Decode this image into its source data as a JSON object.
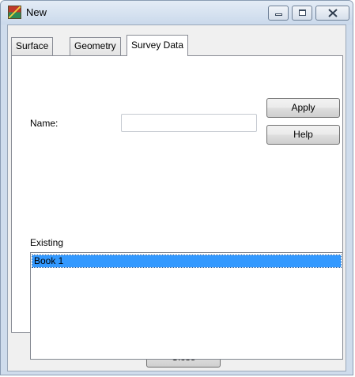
{
  "window": {
    "title": "New"
  },
  "tabs": [
    {
      "label": "Surface",
      "active": false
    },
    {
      "label": "Geometry",
      "active": false
    },
    {
      "label": "Survey Data",
      "active": true
    }
  ],
  "form": {
    "name_label": "Name:",
    "name_value": "",
    "apply_label": "Apply",
    "help_label": "Help",
    "existing_label": "Existing",
    "existing_items": [
      {
        "label": "Book 1",
        "selected": true
      }
    ]
  },
  "footer": {
    "close_label": "Close"
  },
  "icons": {
    "app": "survey-app-icon",
    "minimize": "minimize-icon",
    "maximize": "maximize-icon",
    "close": "close-icon"
  }
}
